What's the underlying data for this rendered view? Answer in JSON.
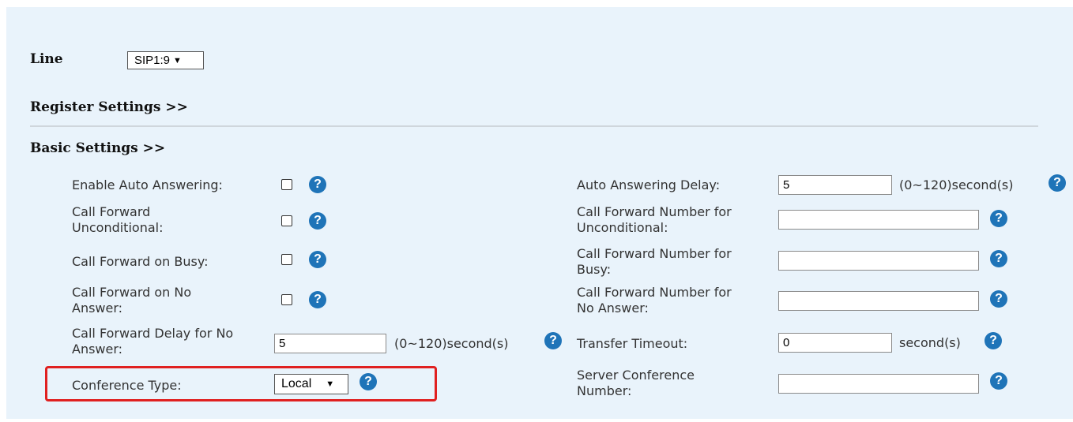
{
  "line": {
    "label": "Line",
    "selected": "SIP1:9"
  },
  "sections": {
    "register": "Register Settings >>",
    "basic": "Basic Settings >>"
  },
  "left": {
    "auto_answer": "Enable Auto Answering:",
    "cf_uncond_1": "Call Forward",
    "cf_uncond_2": "Unconditional:",
    "cf_busy": "Call Forward on Busy:",
    "cf_noans_1": "Call Forward on No",
    "cf_noans_2": "Answer:",
    "cf_delay_1": "Call Forward Delay for No",
    "cf_delay_2": "Answer:",
    "cf_delay_value": "5",
    "cf_delay_unit": "(0~120)second(s)",
    "conf_type": "Conference Type:",
    "conf_type_selected": "Local"
  },
  "right": {
    "auto_delay": "Auto Answering Delay:",
    "auto_delay_value": "5",
    "auto_delay_unit": "(0~120)second(s)",
    "cfn_uncond_1": "Call Forward Number for",
    "cfn_uncond_2": "Unconditional:",
    "cfn_busy_1": "Call Forward Number for",
    "cfn_busy_2": "Busy:",
    "cfn_noans_1": "Call Forward Number for",
    "cfn_noans_2": "No Answer:",
    "transfer": "Transfer Timeout:",
    "transfer_value": "0",
    "transfer_unit": "second(s)",
    "server_conf_1": "Server Conference",
    "server_conf_2": "Number:"
  },
  "help_glyph": "?",
  "chevron_glyph": "⌄",
  "colors": {
    "panel_bg": "#e9f3fb",
    "help_icon": "#1f74b8",
    "highlight": "#e02020"
  }
}
